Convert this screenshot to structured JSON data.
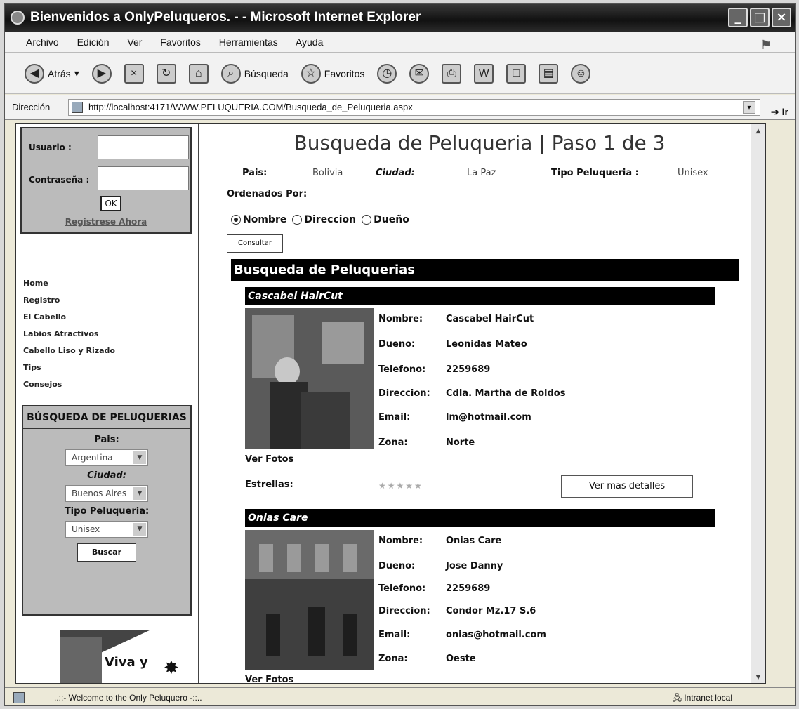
{
  "window": {
    "title": "Bienvenidos a OnlyPeluqueros. - - Microsoft Internet Explorer"
  },
  "menu": [
    "Archivo",
    "Edición",
    "Ver",
    "Favoritos",
    "Herramientas",
    "Ayuda"
  ],
  "toolbar": {
    "back": "Atrás",
    "search": "Búsqueda",
    "favorites": "Favoritos"
  },
  "address": {
    "label": "Dirección",
    "url": "http://localhost:4171/WWW.PELUQUERIA.COM/Busqueda_de_Peluqueria.aspx",
    "go": "Ir"
  },
  "login": {
    "user_label": "Usuario :",
    "pass_label": "Contraseña :",
    "ok": "OK",
    "register": "Registrese Ahora"
  },
  "nav": [
    "Home",
    "Registro",
    "El Cabello",
    "Labios Atractivos",
    "Cabello Liso y Rizado",
    "Tips",
    "Consejos"
  ],
  "search_box": {
    "title": "BÚSQUEDA DE PELUQUERIAS",
    "pais_label": "Pais:",
    "pais_value": "Argentina",
    "ciudad_label": "Ciudad:",
    "ciudad_value": "Buenos Aires",
    "tipo_label": "Tipo Peluqueria:",
    "tipo_value": "Unisex",
    "button": "Buscar"
  },
  "ad": {
    "text": "Viva y"
  },
  "main": {
    "heading": "Busqueda de Peluqueria | Paso 1 de 3",
    "pais_label": "Pais:",
    "pais_value": "Bolivia",
    "ciudad_label": "Ciudad:",
    "ciudad_value": "La Paz",
    "tipo_label": "Tipo Peluqueria :",
    "tipo_value": "Unisex",
    "order_label": "Ordenados Por:",
    "order_options": [
      "Nombre",
      "Direccion",
      "Dueño"
    ],
    "consult": "Consultar",
    "results_title": "Busqueda de Peluquerias"
  },
  "labels": {
    "nombre": "Nombre:",
    "dueno": "Dueño:",
    "telefono": "Telefono:",
    "direccion": "Direccion:",
    "email": "Email:",
    "zona": "Zona:",
    "ver_fotos": "Ver Fotos",
    "estrellas": "Estrellas:",
    "ver_mas": "Ver mas detalles",
    "stars": "★★★★★"
  },
  "results": [
    {
      "title": "Cascabel HairCut",
      "nombre": "Cascabel HairCut",
      "dueno": "Leonidas Mateo",
      "telefono": "2259689",
      "direccion": "Cdla. Martha de Roldos",
      "email": "lm@hotmail.com",
      "zona": "Norte"
    },
    {
      "title": "Onias Care",
      "nombre": "Onias Care",
      "dueno": "Jose Danny",
      "telefono": "2259689",
      "direccion": "Condor Mz.17 S.6",
      "email": "onias@hotmail.com",
      "zona": "Oeste"
    }
  ],
  "status": {
    "text": "..::- Welcome to the Only Peluquero -::..",
    "zone": "Intranet local"
  }
}
